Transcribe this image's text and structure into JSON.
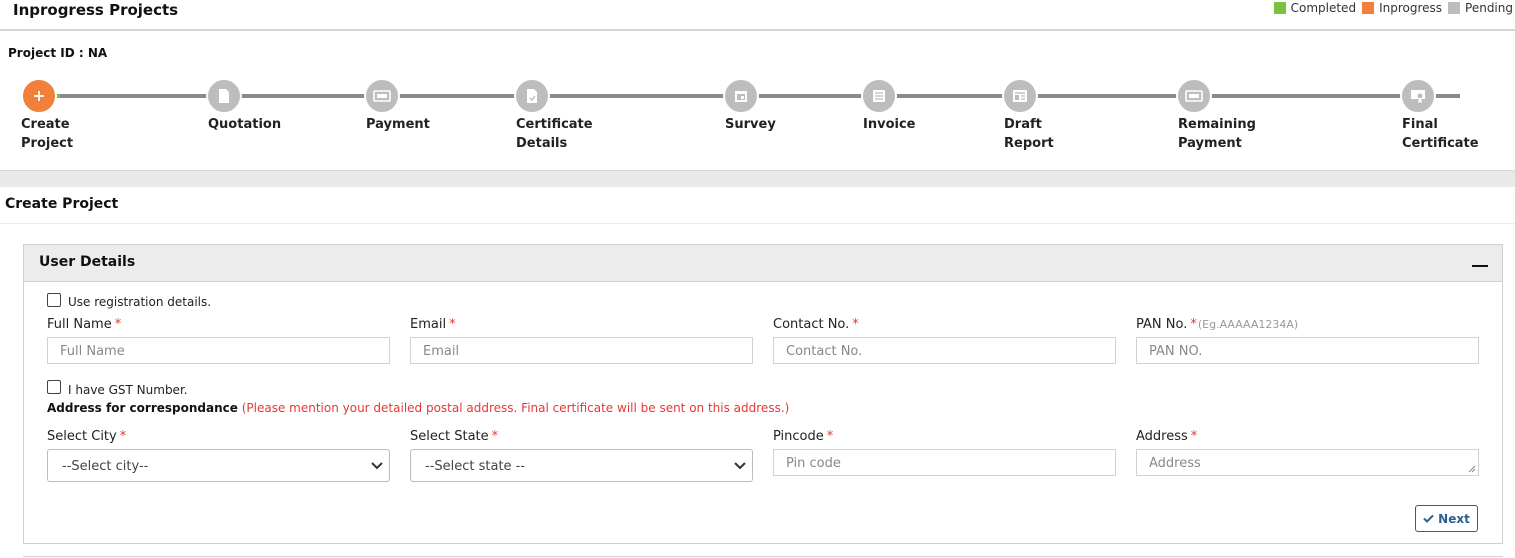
{
  "header": {
    "title": "Inprogress Projects"
  },
  "legend": [
    {
      "label": "Completed",
      "color": "#7cc242"
    },
    {
      "label": "Inprogress",
      "color": "#f0803c"
    },
    {
      "label": "Pending",
      "color": "#bdbdbd"
    }
  ],
  "project": {
    "id_label": "Project ID : NA"
  },
  "steps": [
    {
      "line1": "Create",
      "line2": "Project",
      "icon": "plus-icon",
      "status": "inprogress"
    },
    {
      "line1": "Quotation",
      "line2": "",
      "icon": "document-icon",
      "status": "pending"
    },
    {
      "line1": "Payment",
      "line2": "",
      "icon": "payment-icon",
      "status": "pending"
    },
    {
      "line1": "Certificate",
      "line2": "Details",
      "icon": "certificate-doc-icon",
      "status": "pending"
    },
    {
      "line1": "Survey",
      "line2": "",
      "icon": "calendar-icon",
      "status": "pending"
    },
    {
      "line1": "Invoice",
      "line2": "",
      "icon": "invoice-icon",
      "status": "pending"
    },
    {
      "line1": "Draft",
      "line2": "Report",
      "icon": "report-icon",
      "status": "pending"
    },
    {
      "line1": "Remaining",
      "line2": "Payment",
      "icon": "payment-icon",
      "status": "pending"
    },
    {
      "line1": "Final",
      "line2": "Certificate",
      "icon": "award-icon",
      "status": "pending"
    }
  ],
  "section": {
    "title": "Create Project"
  },
  "panel": {
    "title": "User Details",
    "use_registration_label": "Use registration details.",
    "gst_label": "I have GST Number.",
    "address_heading": "Address for correspondance",
    "address_note": "(Please mention your detailed postal address. Final certificate will be sent on this address.)",
    "next_label": "Next"
  },
  "fields": {
    "full_name": {
      "label": "Full Name",
      "placeholder": "Full Name"
    },
    "email": {
      "label": "Email",
      "placeholder": "Email"
    },
    "contact": {
      "label": "Contact No.",
      "placeholder": "Contact No."
    },
    "pan": {
      "label": "PAN No.",
      "hint": "(Eg.AAAAA1234A)",
      "placeholder": "PAN NO."
    },
    "city": {
      "label": "Select City",
      "selected": "--Select city--"
    },
    "state": {
      "label": "Select State",
      "selected": "--Select state --"
    },
    "pincode": {
      "label": "Pincode",
      "placeholder": "Pin code"
    },
    "address": {
      "label": "Address",
      "placeholder": "Address"
    }
  },
  "required_mark": "*"
}
